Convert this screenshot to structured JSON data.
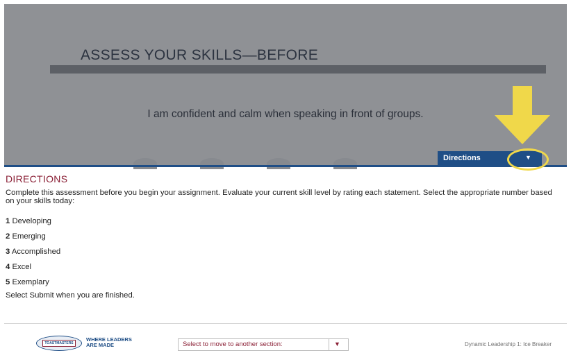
{
  "header": {
    "title": "ASSESS YOUR SKILLS—BEFORE",
    "statement": "I am confident and calm when speaking in front of groups."
  },
  "dropdown": {
    "label": "Directions",
    "caret": "▼"
  },
  "directions": {
    "heading": "DIRECTIONS",
    "body": "Complete this assessment before you begin your assignment. Evaluate your current skill level by rating each statement. Select the appropriate number based on your skills today:",
    "levels": [
      {
        "num": "1",
        "label": "Developing"
      },
      {
        "num": "2",
        "label": "Emerging"
      },
      {
        "num": "3",
        "label": "Accomplished"
      },
      {
        "num": "4",
        "label": "Excel"
      },
      {
        "num": "5",
        "label": "Exemplary"
      }
    ],
    "finish": "Select Submit when you are finished."
  },
  "footer": {
    "logo_text": "TOASTMASTERS",
    "tagline_line1": "WHERE LEADERS",
    "tagline_line2": "ARE MADE",
    "section_select": "Select to move to another section:",
    "section_caret": "▼",
    "path_name": "Dynamic Leadership 1: Ice Breaker"
  },
  "colors": {
    "accent_blue": "#1f4e86",
    "heading_red": "#8a1f35",
    "highlight_yellow": "#f0d84a"
  }
}
